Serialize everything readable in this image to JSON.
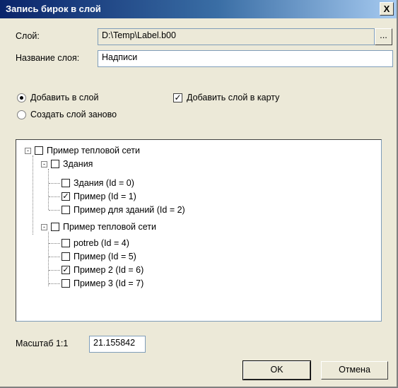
{
  "window": {
    "title": "Запись бирок в слой",
    "close_glyph": "X"
  },
  "layer": {
    "label": "Слой:",
    "path": "D:\\Temp\\Label.b00",
    "browse_label": "..."
  },
  "layer_name": {
    "label": "Название слоя:",
    "value": "Надписи"
  },
  "options": {
    "add_to_layer": {
      "label": "Добавить в слой",
      "selected": true
    },
    "recreate_layer": {
      "label": "Создать слой заново",
      "selected": false
    },
    "add_layer_to_map": {
      "label": "Добавить слой в карту",
      "checked": true
    }
  },
  "tree": {
    "root": {
      "label": "Пример тепловой сети",
      "expander": "-",
      "checked": false
    },
    "groups": [
      {
        "label": "Здания",
        "expander": "-",
        "checked": false,
        "items": [
          {
            "label": "Здания (Id = 0)",
            "checked": false
          },
          {
            "label": "Пример (Id = 1)",
            "checked": true
          },
          {
            "label": "Пример для зданий (Id = 2)",
            "checked": false
          }
        ]
      },
      {
        "label": "Пример тепловой сети",
        "expander": "-",
        "checked": false,
        "items": [
          {
            "label": "potreb (Id = 4)",
            "checked": false
          },
          {
            "label": "Пример  (Id = 5)",
            "checked": false
          },
          {
            "label": "Пример 2 (Id = 6)",
            "checked": true
          },
          {
            "label": "Пример 3 (Id = 7)",
            "checked": false
          }
        ]
      }
    ]
  },
  "scale": {
    "label": "Масштаб 1:1",
    "value": "21.155842"
  },
  "buttons": {
    "ok": "OK",
    "cancel": "Отмена"
  },
  "check_glyph": "✓",
  "colors": {
    "titlebar_start": "#0a246a",
    "titlebar_end": "#a6caf0",
    "face": "#ece9d8"
  }
}
